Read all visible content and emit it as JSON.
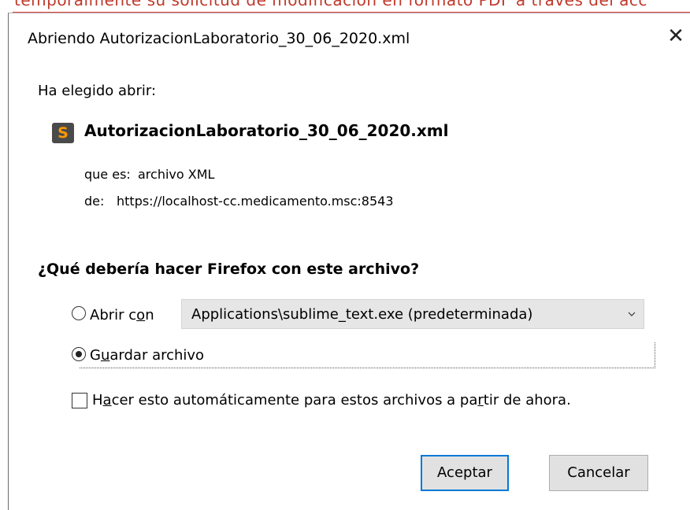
{
  "background_page": {
    "partial_text": "temporalmente su solicitud de modificacion en formato PDF a través del acc"
  },
  "dialog": {
    "title": "Abriendo AutorizacionLaboratorio_30_06_2020.xml",
    "close_glyph": "✕",
    "opened_label": "Ha elegido abrir:",
    "file": {
      "icon": "sublime-text-icon",
      "name": "AutorizacionLaboratorio_30_06_2020.xml",
      "type_label": "que es:",
      "type_value": "archivo XML",
      "from_label": "de:",
      "from_value": "https://localhost-cc.medicamento.msc:8543"
    },
    "question": "¿Qué debería hacer Firefox con este archivo?",
    "open_with": {
      "label_pre": "Abrir c",
      "label_accel": "o",
      "label_post": "n",
      "selected": false,
      "application": "Applications\\sublime_text.exe (predeterminada)"
    },
    "save_file": {
      "label_pre": "G",
      "label_accel": "u",
      "label_post": "ardar archivo",
      "selected": true
    },
    "auto_checkbox": {
      "label_pre": "H",
      "label_accel": "a",
      "label_mid": "cer esto automáticamente para estos archivos a pa",
      "label_accel2": "r",
      "label_post": "tir de ahora.",
      "checked": false
    },
    "buttons": {
      "accept": "Aceptar",
      "cancel": "Cancelar"
    },
    "colors": {
      "default_button_border": "#0078d7",
      "button_bg": "#e1e1e1",
      "select_bg": "#e6e6e6",
      "icon_orange": "#ff9a00"
    }
  }
}
